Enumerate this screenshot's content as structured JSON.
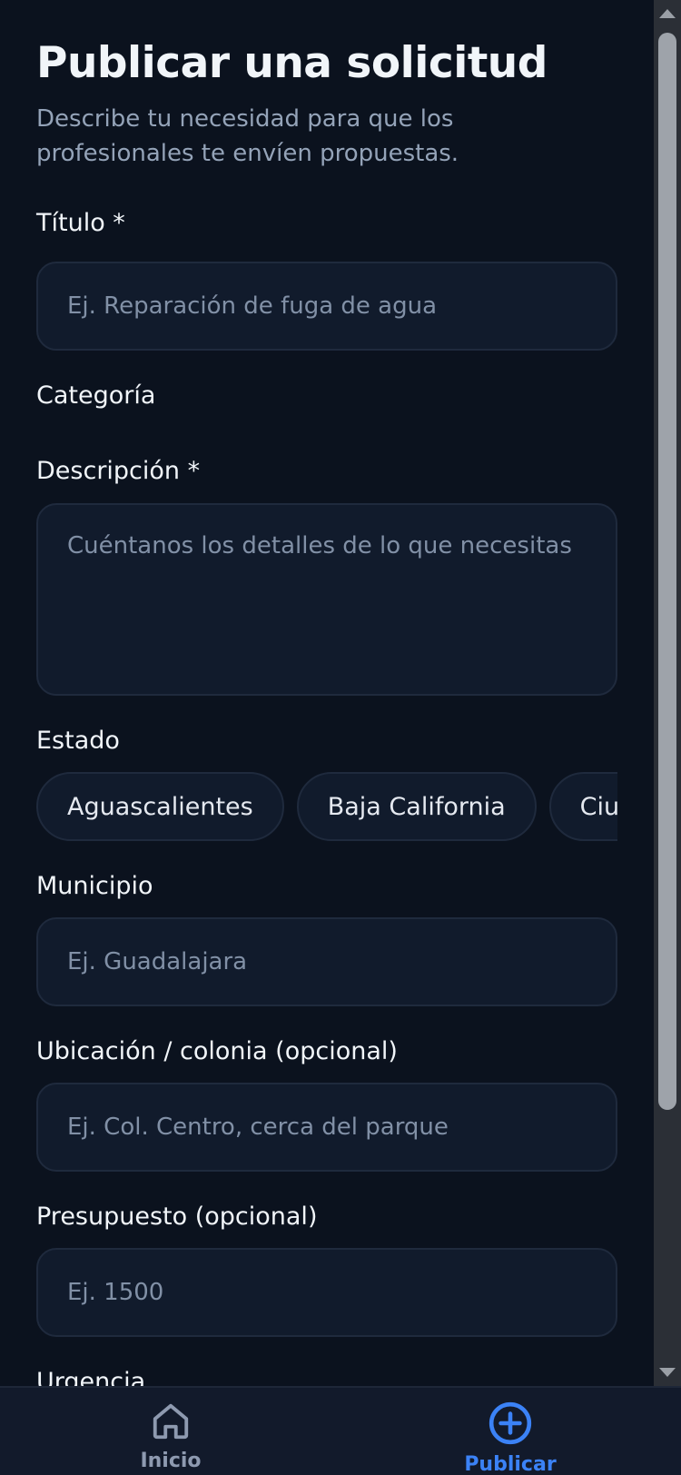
{
  "header": {
    "title": "Publicar una solicitud",
    "subtitle": "Describe tu necesidad para que los profesionales te envíen propuestas."
  },
  "form": {
    "titulo": {
      "label": "Título *",
      "placeholder": "Ej. Reparación de fuga de agua"
    },
    "categoria": {
      "label": "Categoría"
    },
    "descripcion": {
      "label": "Descripción *",
      "placeholder": "Cuéntanos los detalles de lo que necesitas"
    },
    "estado": {
      "label": "Estado",
      "options": [
        "Aguascalientes",
        "Baja California",
        "Ciudad de México"
      ]
    },
    "municipio": {
      "label": "Municipio",
      "placeholder": "Ej. Guadalajara"
    },
    "ubicacion": {
      "label": "Ubicación / colonia (opcional)",
      "placeholder": "Ej. Col. Centro, cerca del parque"
    },
    "presupuesto": {
      "label": "Presupuesto (opcional)",
      "placeholder": "Ej. 1500"
    },
    "urgencia": {
      "label": "Urgencia"
    }
  },
  "nav": {
    "items": [
      {
        "label": "Inicio",
        "icon": "home-icon",
        "active": false
      },
      {
        "label": "Publicar",
        "icon": "plus-circle-icon",
        "active": true
      }
    ]
  },
  "colors": {
    "background": "#0b121e",
    "input_bg": "#111b2c",
    "border": "#1f2a3d",
    "accent": "#3b82f6",
    "muted_text": "#94a3b8"
  }
}
